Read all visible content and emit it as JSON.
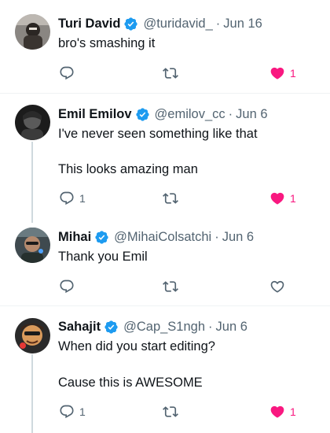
{
  "replies": [
    {
      "name": "Turi David",
      "handle": "@turidavid_",
      "separator": "·",
      "date": "Jun 16",
      "lines": [
        "bro's smashing it"
      ],
      "reply_count": "",
      "like_count": "1",
      "liked": true
    },
    {
      "name": "Emil Emilov",
      "handle": "@emilov_cc",
      "separator": "·",
      "date": "Jun 6",
      "lines": [
        "I've never seen something like that",
        "This looks amazing man"
      ],
      "reply_count": "1",
      "like_count": "1",
      "liked": true
    },
    {
      "name": "Mihai",
      "handle": "@MihaiColsatchi",
      "separator": "·",
      "date": "Jun 6",
      "lines": [
        "Thank you Emil"
      ],
      "reply_count": "",
      "like_count": "",
      "liked": false
    },
    {
      "name": "Sahajit",
      "handle": "@Cap_S1ngh",
      "separator": "·",
      "date": "Jun 6",
      "lines": [
        "When did you start editing?",
        "Cause this is AWESOME"
      ],
      "reply_count": "1",
      "like_count": "1",
      "liked": true
    }
  ],
  "colors": {
    "verified": "#1d9bf0",
    "like_active": "#f91880",
    "icon_gray": "#536471"
  },
  "icons": {
    "reply": "reply-icon",
    "retweet": "retweet-icon",
    "like": "heart-icon",
    "verified": "verified-badge-icon"
  }
}
